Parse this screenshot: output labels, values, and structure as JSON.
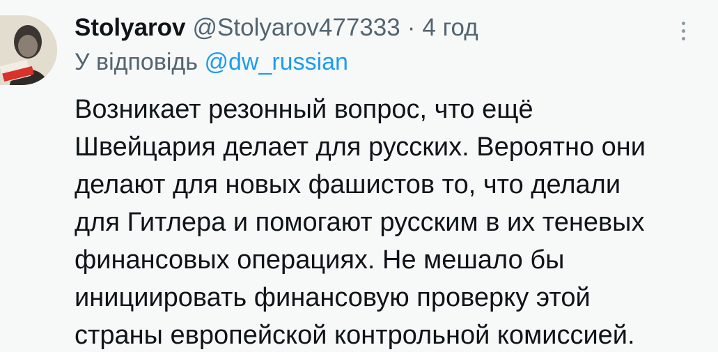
{
  "author": {
    "display_name": "Stolyarov",
    "handle": "@Stolyarov477333",
    "separator": "·",
    "time": "4 год"
  },
  "reply": {
    "prefix": "У відповідь",
    "mention": "@dw_russian"
  },
  "tweet": {
    "lines": [
      "Возникает резонный вопрос, что ещё",
      "Швейцария делает для русских. Вероятно они",
      "делают для новых фашистов то, что делали",
      "для Гитлера и помогают русским в их теневых",
      "финансовых операциях. Не мешало бы",
      "инициировать финансовую проверку этой",
      "страны европейской контрольной комиссией."
    ]
  },
  "icons": {
    "more": "more-vertical-icon",
    "avatar": "user-avatar"
  },
  "colors": {
    "background": "#f7f9f9",
    "text": "#0f1419",
    "secondary": "#536471",
    "link": "#1d9bf0"
  }
}
